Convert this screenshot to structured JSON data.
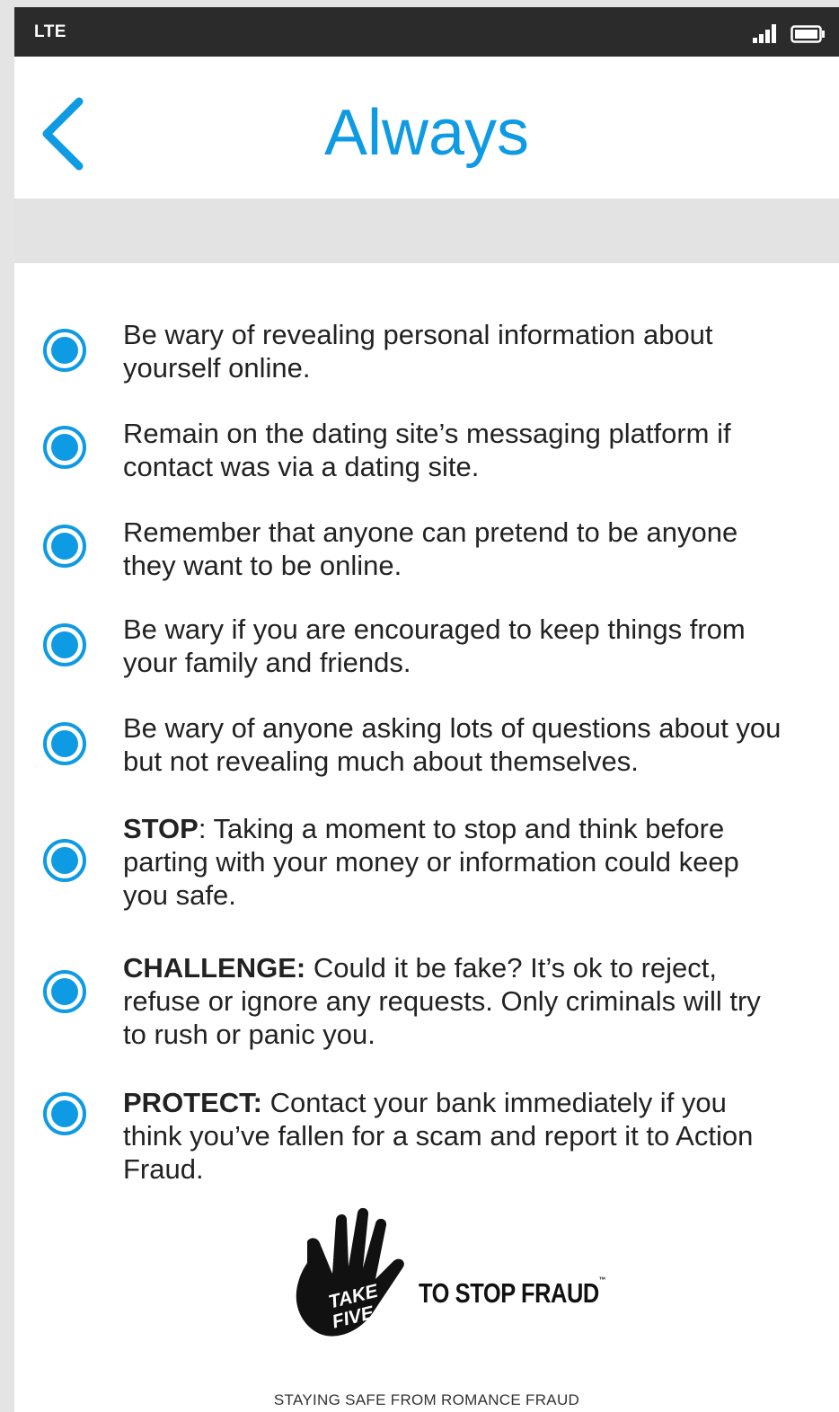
{
  "status_bar": {
    "carrier": "LTE",
    "signal_icon": "signal-bars-icon",
    "battery_icon": "battery-icon"
  },
  "header": {
    "title": "Always",
    "back_icon": "chevron-left-icon"
  },
  "colors": {
    "accent": "#0f9be3",
    "status_bar": "#2b2b2b",
    "band": "#e3e3e3",
    "text": "#222222"
  },
  "tips": [
    {
      "lead": "",
      "text": "Be wary of revealing personal information about yourself online."
    },
    {
      "lead": "",
      "text": "Remain on the dating site’s messaging platform if contact was via a dating site."
    },
    {
      "lead": "",
      "text": "Remember that anyone can pretend to be anyone they want to be online."
    },
    {
      "lead": "",
      "text": "Be wary if you are encouraged to keep things from your family and friends."
    },
    {
      "lead": "",
      "text": "Be wary of anyone asking lots of questions about you but not revealing much about themselves."
    },
    {
      "lead": "STOP",
      "text": ": Taking a moment to stop and think before parting with your money or information could keep you safe."
    },
    {
      "lead": "CHALLENGE:",
      "text": " Could it be fake? It’s ok to reject, refuse or ignore any requests. Only criminals will try to rush or panic you."
    },
    {
      "lead": "PROTECT:",
      "text": " Contact your bank immediately if you think you’ve fallen for a scam and report it to Action Fraud."
    }
  ],
  "logo": {
    "hand_text_1": "TAKE",
    "hand_text_2": "FIVE",
    "tagline": "TO STOP FRAUD",
    "trademark": "™"
  },
  "footer": {
    "text": "STAYING SAFE FROM ROMANCE FRAUD"
  }
}
